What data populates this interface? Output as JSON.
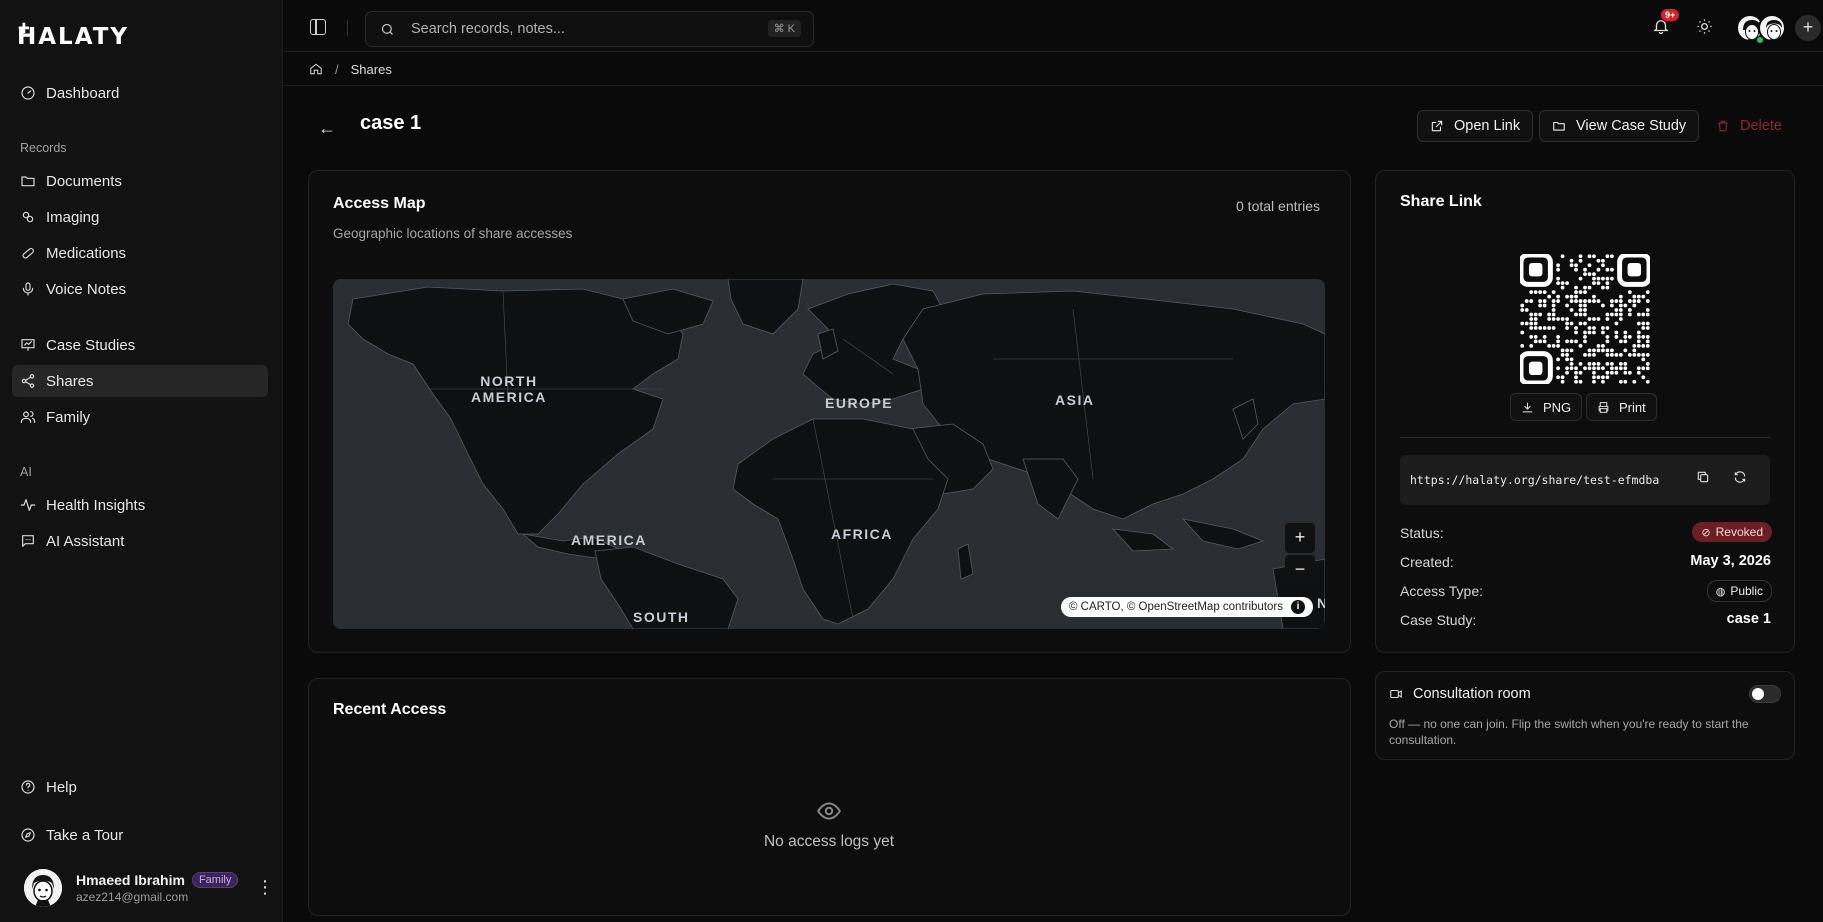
{
  "app": {
    "logo": "HALATY"
  },
  "sidebar": {
    "top_items": [
      {
        "label": "Dashboard",
        "icon": "dashboard-icon"
      }
    ],
    "records_section": "Records",
    "records_items": [
      {
        "label": "Documents",
        "icon": "folder-icon"
      },
      {
        "label": "Imaging",
        "icon": "imaging-icon"
      },
      {
        "label": "Medications",
        "icon": "pill-icon"
      },
      {
        "label": "Voice Notes",
        "icon": "mic-icon"
      }
    ],
    "more_items": [
      {
        "label": "Case Studies",
        "icon": "presentation-icon"
      },
      {
        "label": "Shares",
        "icon": "share-icon",
        "active": true
      },
      {
        "label": "Family",
        "icon": "users-icon"
      }
    ],
    "ai_section": "AI",
    "ai_items": [
      {
        "label": "Health Insights",
        "icon": "activity-icon"
      },
      {
        "label": "AI Assistant",
        "icon": "chat-icon"
      }
    ],
    "bottom_items": [
      {
        "label": "Help",
        "icon": "help-icon"
      },
      {
        "label": "Take a Tour",
        "icon": "compass-icon"
      }
    ],
    "user": {
      "name": "Hmaeed Ibrahim",
      "badge": "Family",
      "email": "azez214@gmail.com"
    }
  },
  "topbar": {
    "search_placeholder": "Search records, notes...",
    "shortcut": "⌘ K",
    "notifications_badge": "9+"
  },
  "breadcrumb": {
    "current": "Shares"
  },
  "page": {
    "title": "case 1",
    "actions": {
      "open_link": "Open Link",
      "view_case_study": "View Case Study",
      "delete": "Delete"
    }
  },
  "access_map": {
    "title": "Access Map",
    "subtitle": "Geographic locations of share accesses",
    "total": "0 total entries",
    "labels": {
      "north_america": "NORTH\nAMERICA",
      "europe": "EUROPE",
      "asia": "ASIA",
      "africa": "AFRICA",
      "america": "AMERICA",
      "south": "SOUTH",
      "edge": "N"
    },
    "zoom_in": "+",
    "zoom_out": "−",
    "attribution": "© CARTO, © OpenStreetMap contributors",
    "attribution_info": "i"
  },
  "recent_access": {
    "title": "Recent Access",
    "empty": "No access logs yet"
  },
  "share_link": {
    "title": "Share Link",
    "png": "PNG",
    "print": "Print",
    "url": "https://halaty.org/share/test-efmdba",
    "status_label": "Status:",
    "status_value": "Revoked",
    "created_label": "Created:",
    "created_value": "May 3, 2026",
    "access_type_label": "Access Type:",
    "access_type_value": "Public",
    "case_study_label": "Case Study:",
    "case_study_value": "case 1"
  },
  "consultation": {
    "title": "Consultation room",
    "description": "Off — no one can join. Flip the switch when you're ready to start the consultation.",
    "enabled": false
  },
  "colors": {
    "accent_red": "#e11d2a",
    "revoked_bg": "#6b1f24",
    "online": "#22c55e",
    "badge_purple": "#3b2556"
  }
}
